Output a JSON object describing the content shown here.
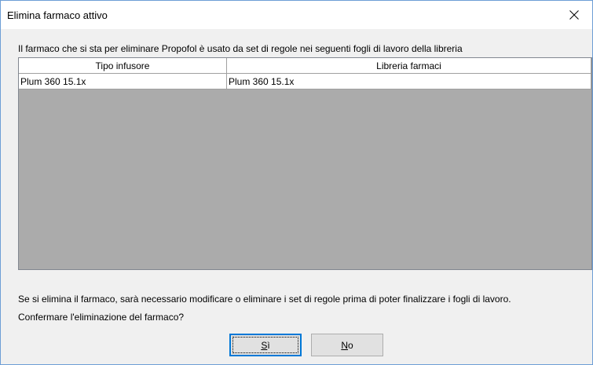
{
  "window": {
    "title": "Elimina farmaco attivo"
  },
  "intro_text": "Il farmaco che si sta per eliminare Propofol è usato da set di regole nei seguenti fogli di lavoro della libreria",
  "table": {
    "columns": [
      "Tipo infusore",
      "Libreria farmaci"
    ],
    "rows": [
      [
        "Plum 360 15.1x",
        "Plum 360 15.1x"
      ]
    ]
  },
  "warning_text": "Se si elimina il farmaco, sarà necessario modificare o eliminare i set di regole prima di poter finalizzare i fogli di lavoro.",
  "question_text": "Confermare l'eliminazione del farmaco?",
  "buttons": {
    "yes_mnemonic": "S",
    "yes_rest": "ì",
    "no_mnemonic": "N",
    "no_rest": "o"
  }
}
